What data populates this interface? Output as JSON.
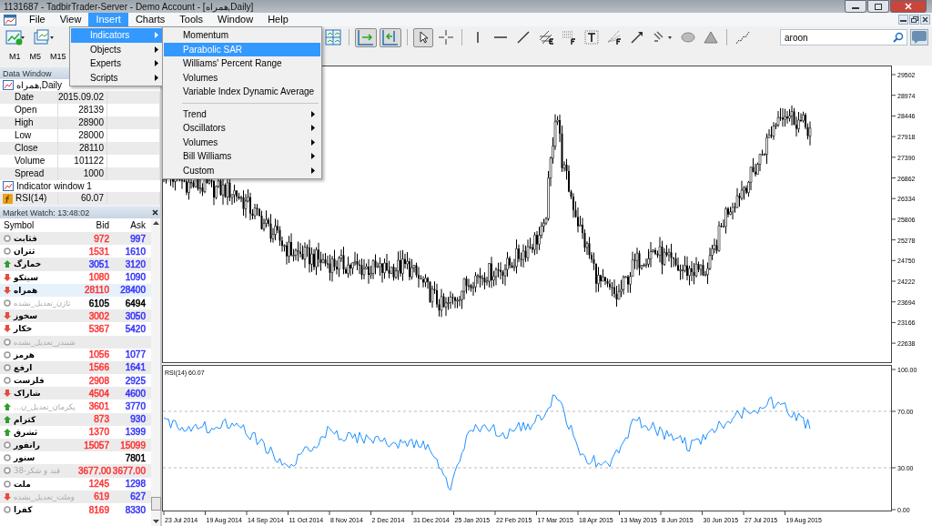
{
  "window": {
    "title": "1131687 - TadbirTrader-Server - Demo Account - [همراه,Daily]"
  },
  "menu_bar": [
    {
      "label": "File",
      "selected": false
    },
    {
      "label": "View",
      "selected": false
    },
    {
      "label": "Insert",
      "selected": true
    },
    {
      "label": "Charts",
      "selected": false
    },
    {
      "label": "Tools",
      "selected": false
    },
    {
      "label": "Window",
      "selected": false
    },
    {
      "label": "Help",
      "selected": false
    }
  ],
  "insert_menu": {
    "items": [
      {
        "label": "Indicators",
        "selected": true,
        "submenu": true
      },
      {
        "label": "Objects",
        "selected": false,
        "submenu": true
      },
      {
        "label": "Experts",
        "selected": false,
        "submenu": true
      },
      {
        "label": "Scripts",
        "selected": false,
        "submenu": true
      }
    ]
  },
  "indicators_menu": {
    "sections": [
      {
        "items": [
          {
            "label": "Momentum",
            "selected": false,
            "submenu": false
          },
          {
            "label": "Parabolic SAR",
            "selected": true,
            "submenu": false
          },
          {
            "label": "Williams' Percent Range",
            "selected": false,
            "submenu": false
          },
          {
            "label": "Volumes",
            "selected": false,
            "submenu": false
          },
          {
            "label": "Variable Index Dynamic Average",
            "selected": false,
            "submenu": false
          }
        ]
      },
      {
        "items": [
          {
            "label": "Trend",
            "selected": false,
            "submenu": true
          },
          {
            "label": "Oscillators",
            "selected": false,
            "submenu": true
          },
          {
            "label": "Volumes",
            "selected": false,
            "submenu": true
          },
          {
            "label": "Bill Williams",
            "selected": false,
            "submenu": true
          },
          {
            "label": "Custom",
            "selected": false,
            "submenu": true
          }
        ]
      }
    ]
  },
  "timeframes": [
    {
      "label": "M1"
    },
    {
      "label": "M5"
    },
    {
      "label": "M15"
    }
  ],
  "search": {
    "value": "aroon"
  },
  "data_window": {
    "title": "Data Window",
    "symbol": "همراه,Daily",
    "rows": [
      {
        "label": "Date",
        "value": "2015.09.02"
      },
      {
        "label": "Open",
        "value": "28139"
      },
      {
        "label": "High",
        "value": "28900"
      },
      {
        "label": "Low",
        "value": "28000"
      },
      {
        "label": "Close",
        "value": "28110"
      },
      {
        "label": "Volume",
        "value": "101122"
      },
      {
        "label": "Spread",
        "value": "1000"
      }
    ],
    "indicator_window": "Indicator window 1",
    "indicator": {
      "label": "RSI(14)",
      "value": "60.07"
    }
  },
  "market_watch": {
    "title": "Market Watch: 13:48:02",
    "columns": [
      "Symbol",
      "Bid",
      "Ask"
    ],
    "rows": [
      {
        "symbol": "قثابت",
        "kind": "none",
        "disabled": false,
        "selected": false,
        "bid": {
          "text": "972",
          "color": "#ff3333"
        },
        "ask": {
          "text": "997",
          "color": "#3333ff"
        }
      },
      {
        "symbol": "ثتران",
        "kind": "none",
        "disabled": false,
        "selected": false,
        "bid": {
          "text": "1531",
          "color": "#ff3333"
        },
        "ask": {
          "text": "1610",
          "color": "#3333ff"
        }
      },
      {
        "symbol": "خمارگ",
        "kind": "up",
        "disabled": false,
        "selected": false,
        "bid": {
          "text": "3051",
          "color": "#3333ff"
        },
        "ask": {
          "text": "3120",
          "color": "#3333ff"
        }
      },
      {
        "symbol": "سیتکو",
        "kind": "down",
        "disabled": false,
        "selected": false,
        "bid": {
          "text": "1080",
          "color": "#ff3333"
        },
        "ask": {
          "text": "1090",
          "color": "#3333ff"
        }
      },
      {
        "symbol": "همراه",
        "kind": "down",
        "disabled": false,
        "selected": true,
        "bid": {
          "text": "28110",
          "color": "#ff3333"
        },
        "ask": {
          "text": "28400",
          "color": "#3333ff"
        }
      },
      {
        "symbol": "ثاژن_تعدیل_نشده",
        "kind": "none",
        "disabled": true,
        "selected": false,
        "bid": {
          "text": "6105",
          "color": "#000000"
        },
        "ask": {
          "text": "6494",
          "color": "#000000"
        }
      },
      {
        "symbol": "سخوز",
        "kind": "down",
        "disabled": false,
        "selected": false,
        "bid": {
          "text": "3002",
          "color": "#ff3333"
        },
        "ask": {
          "text": "3050",
          "color": "#3333ff"
        }
      },
      {
        "symbol": "خکار",
        "kind": "down",
        "disabled": false,
        "selected": false,
        "bid": {
          "text": "5367",
          "color": "#ff3333"
        },
        "ask": {
          "text": "5420",
          "color": "#3333ff"
        }
      },
      {
        "symbol": "شبندر_تعدیل_نشده",
        "kind": "none",
        "disabled": true,
        "selected": false
      },
      {
        "symbol": "هرمز",
        "kind": "none",
        "disabled": false,
        "selected": false,
        "bid": {
          "text": "1056",
          "color": "#ff3333"
        },
        "ask": {
          "text": "1077",
          "color": "#3333ff"
        }
      },
      {
        "symbol": "ارفع",
        "kind": "none",
        "disabled": false,
        "selected": false,
        "bid": {
          "text": "1566",
          "color": "#ff3333"
        },
        "ask": {
          "text": "1641",
          "color": "#3333ff"
        }
      },
      {
        "symbol": "قلرست",
        "kind": "none",
        "disabled": false,
        "selected": false,
        "bid": {
          "text": "2908",
          "color": "#ff3333"
        },
        "ask": {
          "text": "2925",
          "color": "#3333ff"
        }
      },
      {
        "symbol": "شاراک",
        "kind": "down",
        "disabled": false,
        "selected": false,
        "bid": {
          "text": "4504",
          "color": "#ff3333"
        },
        "ask": {
          "text": "4600",
          "color": "#3333ff"
        }
      },
      {
        "symbol": "پکرمان_تعدیل_ن...",
        "kind": "up",
        "disabled": true,
        "selected": false,
        "bid": {
          "text": "3601",
          "color": "#ff3333"
        },
        "ask": {
          "text": "3770",
          "color": "#3333ff"
        }
      },
      {
        "symbol": "کترام",
        "kind": "up",
        "disabled": false,
        "selected": false,
        "bid": {
          "text": "873",
          "color": "#ff3333"
        },
        "ask": {
          "text": "930",
          "color": "#3333ff"
        }
      },
      {
        "symbol": "ثشرق",
        "kind": "up",
        "disabled": false,
        "selected": false,
        "bid": {
          "text": "1370",
          "color": "#ff3333"
        },
        "ask": {
          "text": "1399",
          "color": "#3333ff"
        }
      },
      {
        "symbol": "رانفور",
        "kind": "none",
        "disabled": false,
        "selected": false,
        "bid": {
          "text": "15057",
          "color": "#ff3333"
        },
        "ask": {
          "text": "15099",
          "color": "#ff3333"
        }
      },
      {
        "symbol": "سنور",
        "kind": "none",
        "disabled": false,
        "selected": false,
        "ask": {
          "text": "7801",
          "color": "#000000"
        }
      },
      {
        "symbol": "قند و شکر-38",
        "kind": "none",
        "disabled": true,
        "selected": false,
        "bid": {
          "text": "3677.00",
          "color": "#ff3333"
        },
        "ask": {
          "text": "3677.00",
          "color": "#ff3333"
        }
      },
      {
        "symbol": "ملت",
        "kind": "none",
        "disabled": false,
        "selected": false,
        "bid": {
          "text": "1245",
          "color": "#ff3333"
        },
        "ask": {
          "text": "1298",
          "color": "#3333ff"
        }
      },
      {
        "symbol": "وملت_تعدیل_نشده",
        "kind": "down",
        "disabled": true,
        "selected": false,
        "bid": {
          "text": "619",
          "color": "#ff3333"
        },
        "ask": {
          "text": "627",
          "color": "#3333ff"
        }
      },
      {
        "symbol": "کفرا",
        "kind": "none",
        "disabled": false,
        "selected": false,
        "bid": {
          "text": "8169",
          "color": "#ff3333"
        },
        "ask": {
          "text": "8330",
          "color": "#3333ff"
        }
      }
    ]
  },
  "chart": {
    "price_ticks": [
      "29502",
      "28974",
      "28446",
      "27918",
      "27390",
      "26862",
      "26334",
      "25806",
      "25278",
      "24750",
      "24222",
      "23694",
      "23166",
      "22638"
    ],
    "rsi_label": "RSI(14) 60.07",
    "rsi_ticks": [
      "100.00",
      "70.00",
      "30.00",
      "0.00"
    ],
    "dates": [
      "23 Jul 2014",
      "19 Aug 2014",
      "14 Sep 2014",
      "11 Oct 2014",
      "8 Nov 2014",
      "2 Dec 2014",
      "31 Dec 2014",
      "25 Jan 2015",
      "22 Feb 2015",
      "17 Mar 2015",
      "18 Apr 2015",
      "13 May 2015",
      "8 Jun 2015",
      "30 Jun 2015",
      "27 Jul 2015",
      "19 Aug 2015"
    ]
  }
}
